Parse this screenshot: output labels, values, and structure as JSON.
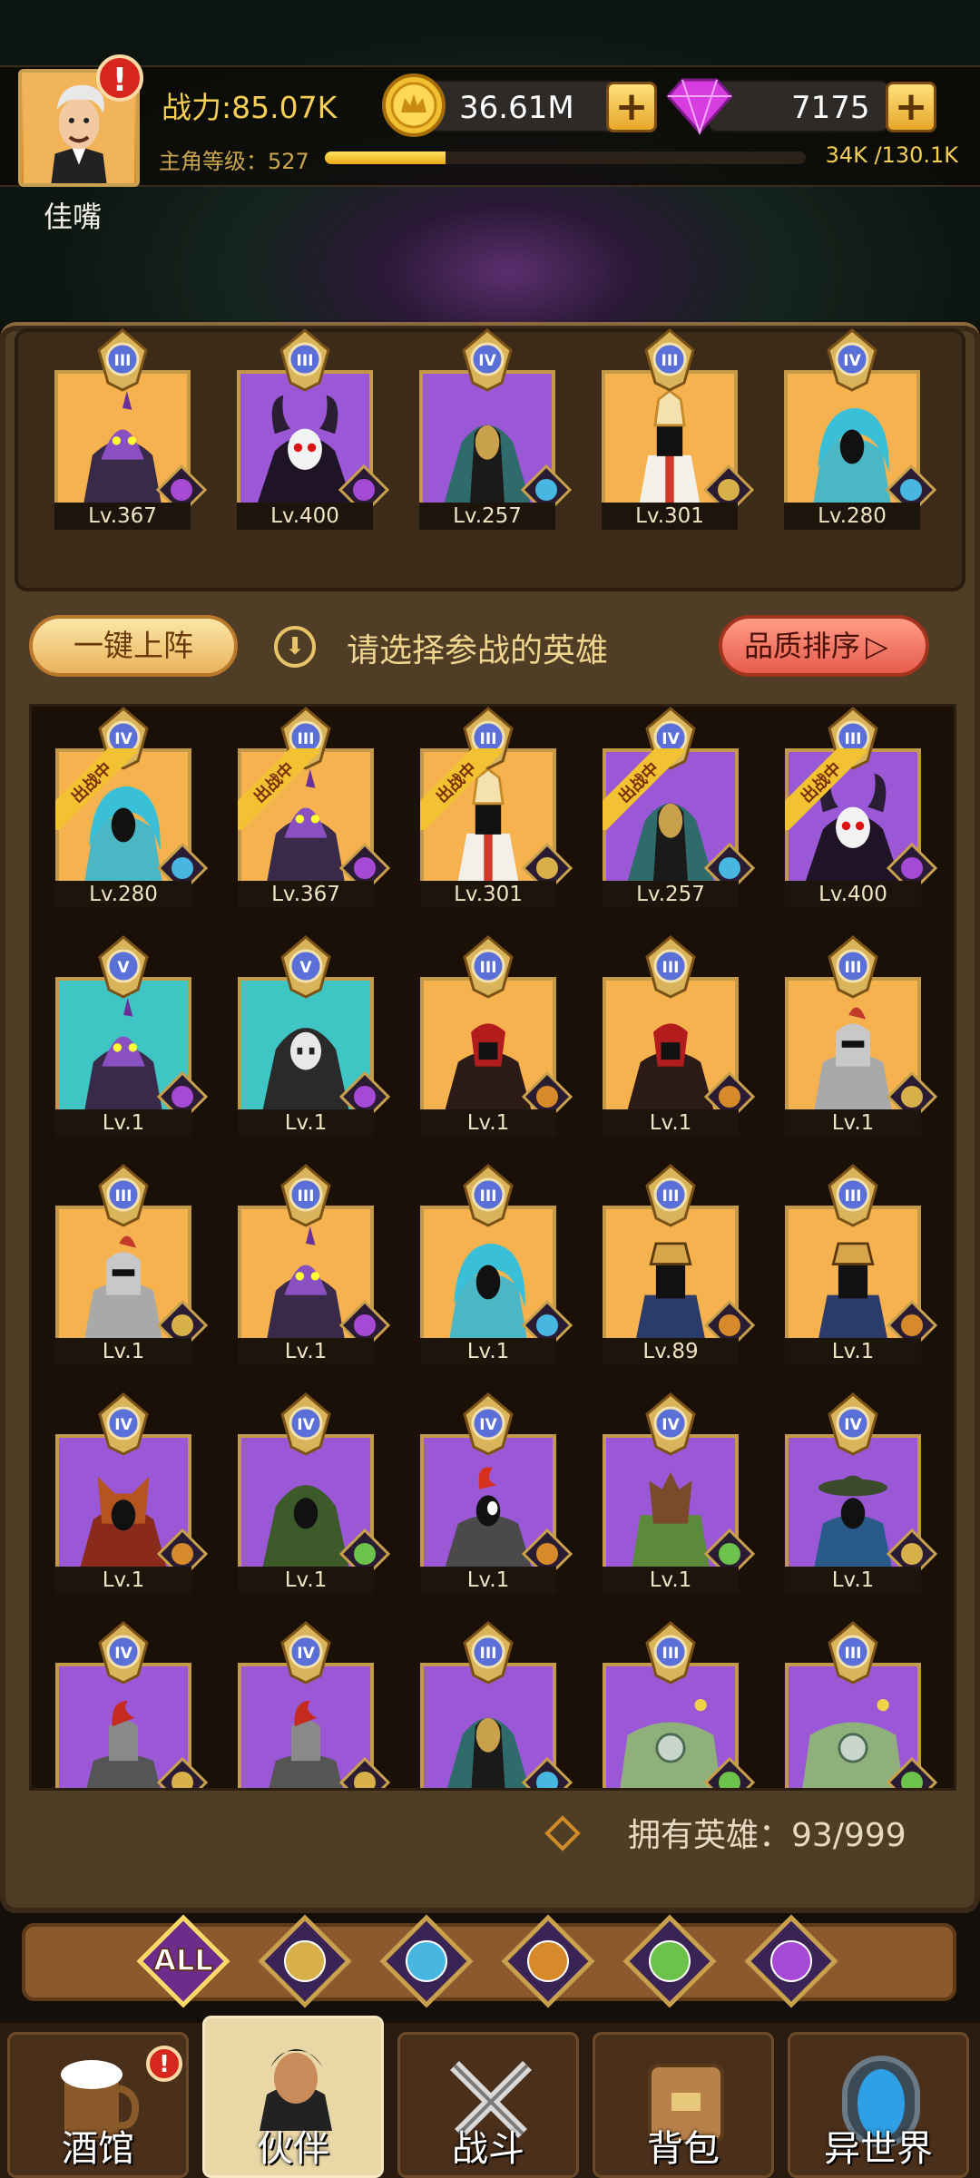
{
  "player": {
    "name": "佳嘴",
    "power": "战力:85.07K",
    "level_label": "主角等级：527",
    "xp_text": "34K /130.1K",
    "xp_fraction": 0.25
  },
  "currency": {
    "gold": "36.61M",
    "gems": "7175"
  },
  "team": [
    {
      "rank": "III",
      "level": "Lv.367",
      "bg": "gold",
      "class": "demon",
      "hero": "purple-dino"
    },
    {
      "rank": "III",
      "level": "Lv.400",
      "bg": "purple",
      "class": "demon",
      "hero": "horn-skull"
    },
    {
      "rank": "IV",
      "level": "Lv.257",
      "bg": "purple",
      "class": "elf",
      "hero": "robe-mage"
    },
    {
      "rank": "III",
      "level": "Lv.301",
      "bg": "gold",
      "class": "human",
      "hero": "priest"
    },
    {
      "rank": "IV",
      "level": "Lv.280",
      "bg": "gold",
      "class": "elf",
      "hero": "blue-hair"
    }
  ],
  "actions": {
    "one_click_deploy": "一键上阵",
    "hint": "请选择参战的英雄",
    "sort_quality": "品质排序",
    "deployed_tag": "出战中"
  },
  "roster": [
    {
      "rank": "IV",
      "level": "Lv.280",
      "bg": "gold",
      "class": "elf",
      "hero": "blue-hair",
      "deployed": true
    },
    {
      "rank": "III",
      "level": "Lv.367",
      "bg": "gold",
      "class": "demon",
      "hero": "purple-dino",
      "deployed": true
    },
    {
      "rank": "III",
      "level": "Lv.301",
      "bg": "gold",
      "class": "human",
      "hero": "priest",
      "deployed": true
    },
    {
      "rank": "IV",
      "level": "Lv.257",
      "bg": "purple",
      "class": "elf",
      "hero": "robe-mage",
      "deployed": true
    },
    {
      "rank": "III",
      "level": "Lv.400",
      "bg": "purple",
      "class": "demon",
      "hero": "horn-skull",
      "deployed": true
    },
    {
      "rank": "V",
      "level": "Lv.1",
      "bg": "teal",
      "class": "demon",
      "hero": "purple-dino",
      "deployed": false
    },
    {
      "rank": "V",
      "level": "Lv.1",
      "bg": "teal",
      "class": "demon",
      "hero": "reaper",
      "deployed": false
    },
    {
      "rank": "III",
      "level": "Lv.1",
      "bg": "gold",
      "class": "beast",
      "hero": "red-mask",
      "deployed": false
    },
    {
      "rank": "III",
      "level": "Lv.1",
      "bg": "gold",
      "class": "beast",
      "hero": "red-mask",
      "deployed": false
    },
    {
      "rank": "III",
      "level": "Lv.1",
      "bg": "gold",
      "class": "human",
      "hero": "knight",
      "deployed": false
    },
    {
      "rank": "III",
      "level": "Lv.1",
      "bg": "gold",
      "class": "human",
      "hero": "knight",
      "deployed": false
    },
    {
      "rank": "III",
      "level": "Lv.1",
      "bg": "gold",
      "class": "demon",
      "hero": "purple-dino",
      "deployed": false
    },
    {
      "rank": "III",
      "level": "Lv.1",
      "bg": "gold",
      "class": "elf",
      "hero": "blue-hair",
      "deployed": false
    },
    {
      "rank": "III",
      "level": "Lv.89",
      "bg": "gold",
      "class": "beast",
      "hero": "pharaoh",
      "deployed": false
    },
    {
      "rank": "III",
      "level": "Lv.1",
      "bg": "gold",
      "class": "beast",
      "hero": "pharaoh",
      "deployed": false
    },
    {
      "rank": "IV",
      "level": "Lv.1",
      "bg": "purple",
      "class": "beast",
      "hero": "fox",
      "deployed": false
    },
    {
      "rank": "IV",
      "level": "Lv.1",
      "bg": "purple",
      "class": "nature",
      "hero": "green-hood",
      "deployed": false
    },
    {
      "rank": "IV",
      "level": "Lv.1",
      "bg": "purple",
      "class": "beast",
      "hero": "red-crest",
      "deployed": false
    },
    {
      "rank": "IV",
      "level": "Lv.1",
      "bg": "purple",
      "class": "nature",
      "hero": "treant",
      "deployed": false
    },
    {
      "rank": "IV",
      "level": "Lv.1",
      "bg": "purple",
      "class": "human",
      "hero": "feather-hat",
      "deployed": false
    },
    {
      "rank": "IV",
      "level": "",
      "bg": "purple",
      "class": "human",
      "hero": "spartan",
      "deployed": false
    },
    {
      "rank": "IV",
      "level": "",
      "bg": "purple",
      "class": "human",
      "hero": "spartan",
      "deployed": false
    },
    {
      "rank": "III",
      "level": "",
      "bg": "purple",
      "class": "elf",
      "hero": "robe-mage",
      "deployed": false
    },
    {
      "rank": "III",
      "level": "",
      "bg": "purple",
      "class": "nature",
      "hero": "golem",
      "deployed": false
    },
    {
      "rank": "III",
      "level": "",
      "bg": "purple",
      "class": "nature",
      "hero": "golem",
      "deployed": false
    }
  ],
  "owned": {
    "label": "拥有英雄：93/999"
  },
  "filters": [
    "ALL",
    "human",
    "elf",
    "beast",
    "nature",
    "demon"
  ],
  "filter_all_label": "ALL",
  "nav": [
    {
      "label": "酒馆",
      "icon": "beer-mug-icon",
      "alert": true
    },
    {
      "label": "伙伴",
      "icon": "partner-portrait-icon",
      "active": true
    },
    {
      "label": "战斗",
      "icon": "crossed-swords-icon"
    },
    {
      "label": "背包",
      "icon": "backpack-chest-icon"
    },
    {
      "label": "异世界",
      "icon": "portal-icon"
    }
  ],
  "colors": {
    "gold_bg": "#f5b24e",
    "purple_bg": "#9a58d6",
    "teal_bg": "#3fc6c4",
    "accent": "#f5cf55"
  }
}
